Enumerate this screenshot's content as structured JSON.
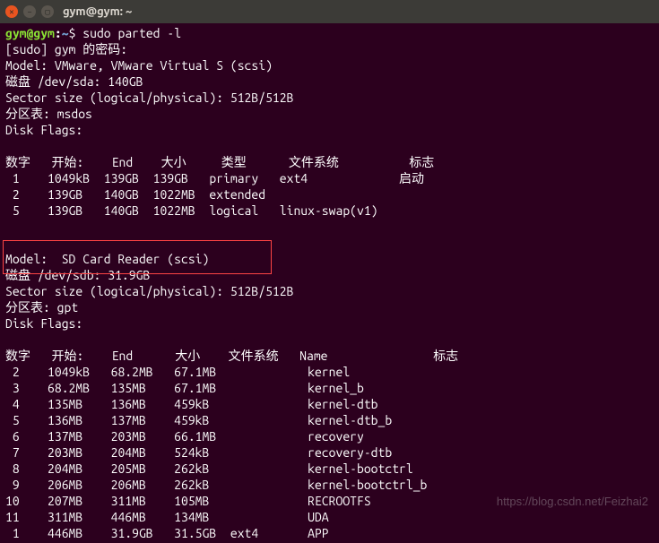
{
  "titlebar": {
    "title": "gym@gym: ~"
  },
  "prompt": {
    "user": "gym",
    "host": "gym",
    "path": "~",
    "symbol": "$"
  },
  "command": "sudo parted -l",
  "sudo_line": "[sudo] gym 的密码:",
  "disk1": {
    "model": "Model: VMware, VMware Virtual S (scsi)",
    "disk": "磁盘 /dev/sda: 140GB",
    "sector": "Sector size (logical/physical): 512B/512B",
    "pt": "分区表: msdos",
    "flags": "Disk Flags:",
    "header": "数字   开始:    End    大小     类型      文件系统          标志",
    "rows": [
      " 1    1049kB  139GB  139GB   primary   ext4             启动",
      " 2    139GB   140GB  1022MB  extended",
      " 5    139GB   140GB  1022MB  logical   linux-swap(v1)"
    ]
  },
  "disk2": {
    "model": "Model:  SD Card Reader (scsi)",
    "disk": "磁盘 /dev/sdb: 31.9GB",
    "sector": "Sector size (logical/physical): 512B/512B",
    "pt": "分区表: gpt",
    "flags": "Disk Flags:",
    "header": "数字   开始:    End      大小    文件系统   Name               标志",
    "rows": [
      " 2    1049kB   68.2MB   67.1MB             kernel",
      " 3    68.2MB   135MB    67.1MB             kernel_b",
      " 4    135MB    136MB    459kB              kernel-dtb",
      " 5    136MB    137MB    459kB              kernel-dtb_b",
      " 6    137MB    203MB    66.1MB             recovery",
      " 7    203MB    204MB    524kB              recovery-dtb",
      " 8    204MB    205MB    262kB              kernel-bootctrl",
      " 9    206MB    206MB    262kB              kernel-bootctrl_b",
      "10    207MB    311MB    105MB              RECROOTFS",
      "11    311MB    446MB    134MB              UDA",
      " 1    446MB    31.9GB   31.5GB  ext4       APP"
    ]
  },
  "watermark": "https://blog.csdn.net/Feizhai2"
}
